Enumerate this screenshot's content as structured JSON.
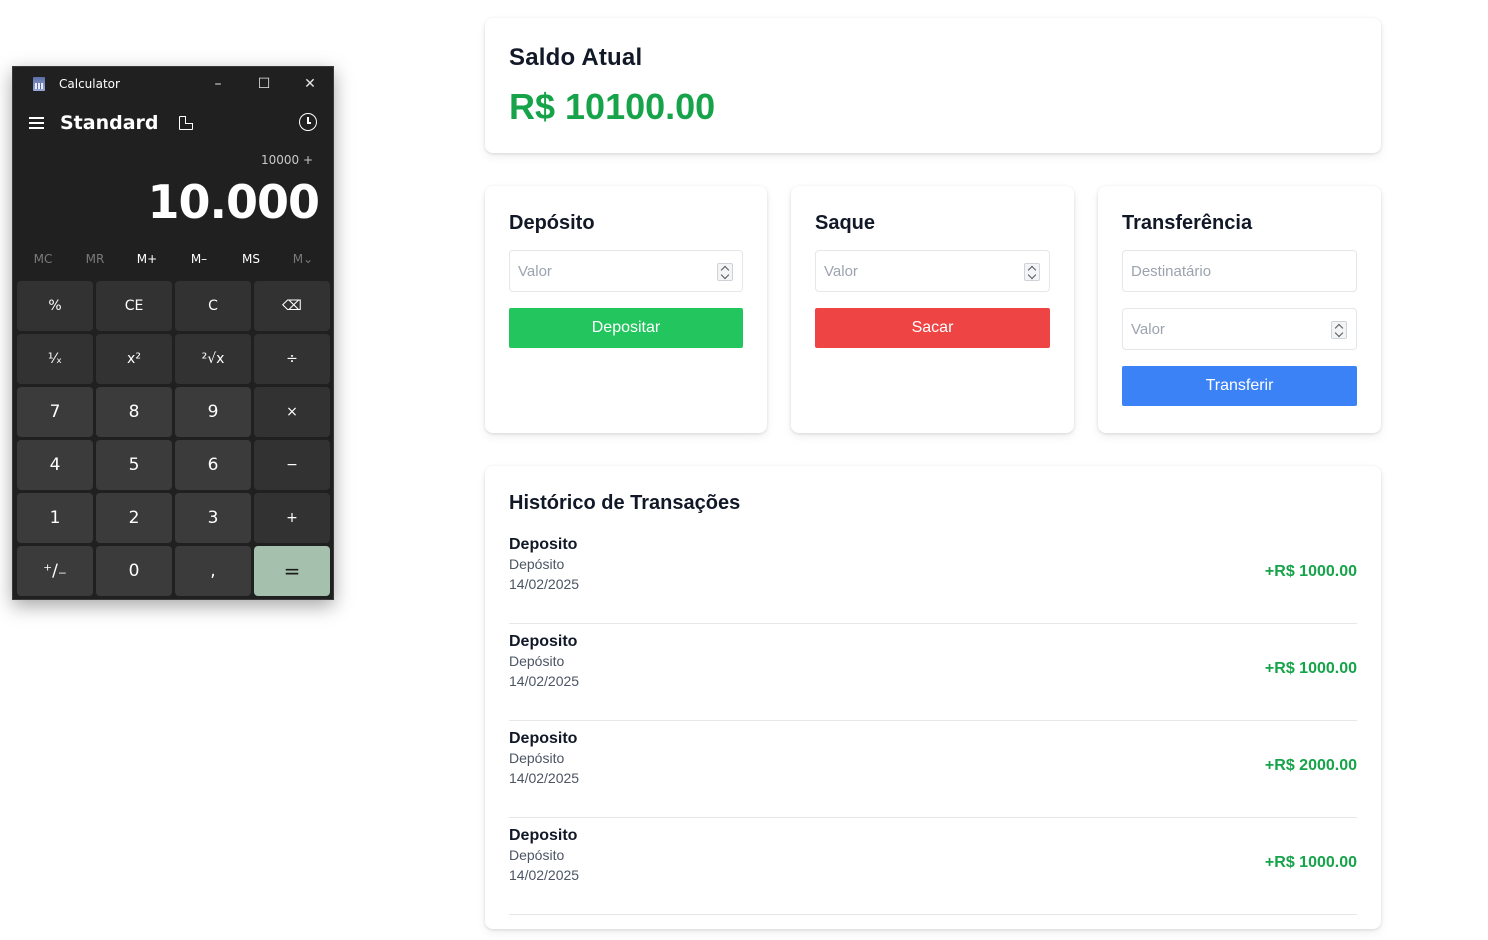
{
  "calculator": {
    "app_title": "Calculator",
    "mode": "Standard",
    "expression": "10000 +",
    "display": "10.000",
    "window_buttons": {
      "minimize": "–",
      "maximize": "☐",
      "close": "✕"
    },
    "memory": [
      {
        "label": "MC",
        "enabled": false
      },
      {
        "label": "MR",
        "enabled": false
      },
      {
        "label": "M+",
        "enabled": true
      },
      {
        "label": "M–",
        "enabled": true
      },
      {
        "label": "MS",
        "enabled": true
      },
      {
        "label": "M⌄",
        "enabled": false
      }
    ],
    "keys": [
      {
        "label": "%",
        "kind": "op"
      },
      {
        "label": "CE",
        "kind": "op"
      },
      {
        "label": "C",
        "kind": "op"
      },
      {
        "label": "⌫",
        "kind": "op"
      },
      {
        "label": "¹⁄ₓ",
        "kind": "op"
      },
      {
        "label": "x²",
        "kind": "op"
      },
      {
        "label": "²√x",
        "kind": "op"
      },
      {
        "label": "÷",
        "kind": "op"
      },
      {
        "label": "7",
        "kind": "num"
      },
      {
        "label": "8",
        "kind": "num"
      },
      {
        "label": "9",
        "kind": "num"
      },
      {
        "label": "×",
        "kind": "op"
      },
      {
        "label": "4",
        "kind": "num"
      },
      {
        "label": "5",
        "kind": "num"
      },
      {
        "label": "6",
        "kind": "num"
      },
      {
        "label": "−",
        "kind": "op"
      },
      {
        "label": "1",
        "kind": "num"
      },
      {
        "label": "2",
        "kind": "num"
      },
      {
        "label": "3",
        "kind": "num"
      },
      {
        "label": "+",
        "kind": "op"
      },
      {
        "label": "⁺∕₋",
        "kind": "num"
      },
      {
        "label": "0",
        "kind": "num"
      },
      {
        "label": ",",
        "kind": "num"
      },
      {
        "label": "=",
        "kind": "eq"
      }
    ],
    "colors": {
      "background": "#202020",
      "equals": "#a5c0ad"
    }
  },
  "balance": {
    "title": "Saldo Atual",
    "value": "R$ 10100.00"
  },
  "deposit": {
    "title": "Depósito",
    "amount_placeholder": "Valor",
    "button": "Depositar"
  },
  "withdraw": {
    "title": "Saque",
    "amount_placeholder": "Valor",
    "button": "Sacar"
  },
  "transfer": {
    "title": "Transferência",
    "recipient_placeholder": "Destinatário",
    "amount_placeholder": "Valor",
    "button": "Transferir"
  },
  "history": {
    "title": "Histórico de Transações",
    "transactions": [
      {
        "type": "Deposito",
        "description": "Depósito",
        "date": "14/02/2025",
        "amount": "+R$ 1000.00"
      },
      {
        "type": "Deposito",
        "description": "Depósito",
        "date": "14/02/2025",
        "amount": "+R$ 1000.00"
      },
      {
        "type": "Deposito",
        "description": "Depósito",
        "date": "14/02/2025",
        "amount": "+R$ 2000.00"
      },
      {
        "type": "Deposito",
        "description": "Depósito",
        "date": "14/02/2025",
        "amount": "+R$ 1000.00"
      }
    ]
  },
  "colors": {
    "positive": "#16a34a",
    "deposit_button": "#22c55e",
    "withdraw_button": "#ef4444",
    "transfer_button": "#3b82f6"
  }
}
